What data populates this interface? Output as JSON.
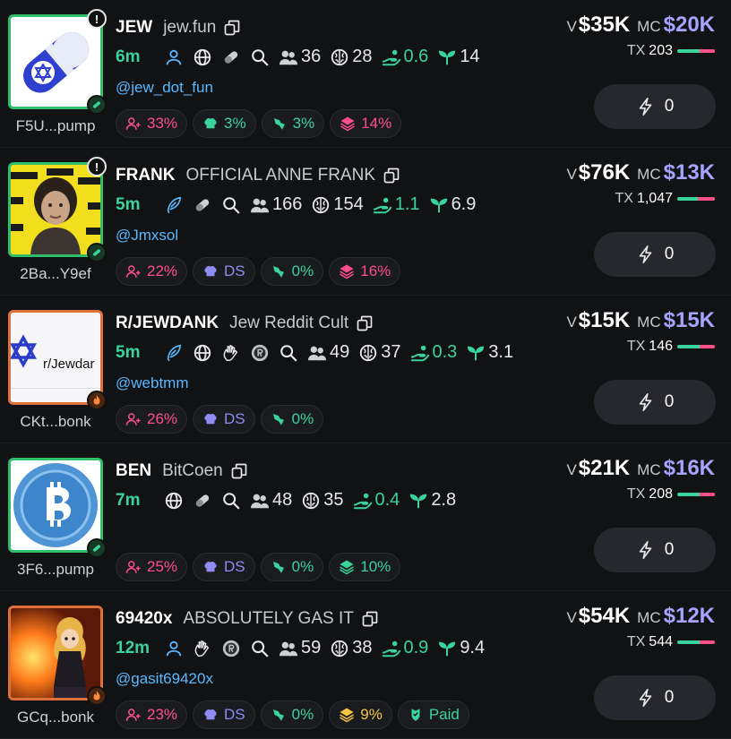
{
  "labels": {
    "volume": "V",
    "market_cap": "MC",
    "tx": "TX",
    "dot": "·"
  },
  "tokens": [
    {
      "ticker": "JEW",
      "name": "jew.fun",
      "age": "6m",
      "address": "F5U...pump",
      "handle": "@jew_dot_fun",
      "warning": "!",
      "holders": "36",
      "top10": "28",
      "dev": "0.6",
      "snipers": "14",
      "volume": "$35K",
      "market_cap": "$20K",
      "tx": "203",
      "buy_ratio": 0.6,
      "buy_amount": "0",
      "source": "pump",
      "pills": [
        {
          "icon": "holders-plus-icon",
          "value": "33%",
          "color": "pink"
        },
        {
          "icon": "chef-hat-icon",
          "value": "3%",
          "color": "grn"
        },
        {
          "icon": "sniper-icon",
          "value": "3%",
          "color": "grn"
        },
        {
          "icon": "layers-icon",
          "value": "14%",
          "color": "pink"
        }
      ]
    },
    {
      "ticker": "FRANK",
      "name": "OFFICIAL ANNE FRANK",
      "age": "5m",
      "address": "2Ba...Y9ef",
      "handle": "@Jmxsol",
      "warning": "!",
      "holders": "166",
      "top10": "154",
      "dev": "1.1",
      "snipers": "6.9",
      "volume": "$76K",
      "market_cap": "$13K",
      "tx": "1,047",
      "buy_ratio": 0.55,
      "buy_amount": "0",
      "source": "pump",
      "pills": [
        {
          "icon": "holders-plus-icon",
          "value": "22%",
          "color": "pink"
        },
        {
          "icon": "chef-hat-icon",
          "value": "DS",
          "color": "vio"
        },
        {
          "icon": "sniper-icon",
          "value": "0%",
          "color": "grn"
        },
        {
          "icon": "layers-icon",
          "value": "16%",
          "color": "pink"
        }
      ]
    },
    {
      "ticker": "R/JEWDANK",
      "name": "Jew Reddit Cult",
      "age": "5m",
      "address": "CKt...bonk",
      "handle": "@webtmm",
      "thumb_text": "r/Jewdar",
      "holders": "49",
      "top10": "37",
      "dev": "0.3",
      "snipers": "3.1",
      "volume": "$15K",
      "market_cap": "$15K",
      "tx": "146",
      "buy_ratio": 0.6,
      "buy_amount": "0",
      "source": "bonk",
      "pills": [
        {
          "icon": "holders-plus-icon",
          "value": "26%",
          "color": "pink"
        },
        {
          "icon": "chef-hat-icon",
          "value": "DS",
          "color": "vio"
        },
        {
          "icon": "sniper-icon",
          "value": "0%",
          "color": "grn"
        }
      ]
    },
    {
      "ticker": "BEN",
      "name": "BitCoen",
      "age": "7m",
      "address": "3F6...pump",
      "handle": "",
      "holders": "48",
      "top10": "35",
      "dev": "0.4",
      "snipers": "2.8",
      "volume": "$21K",
      "market_cap": "$16K",
      "tx": "208",
      "buy_ratio": 0.6,
      "buy_amount": "0",
      "source": "pump",
      "pills": [
        {
          "icon": "holders-plus-icon",
          "value": "25%",
          "color": "pink"
        },
        {
          "icon": "chef-hat-icon",
          "value": "DS",
          "color": "vio"
        },
        {
          "icon": "sniper-icon",
          "value": "0%",
          "color": "grn"
        },
        {
          "icon": "layers-icon",
          "value": "10%",
          "color": "grn"
        }
      ]
    },
    {
      "ticker": "69420x",
      "name": "ABSOLUTELY GAS IT",
      "age": "12m",
      "address": "GCq...bonk",
      "handle": "@gasit69420x",
      "holders": "59",
      "top10": "38",
      "dev": "0.9",
      "snipers": "9.4",
      "volume": "$54K",
      "market_cap": "$12K",
      "tx": "544",
      "buy_ratio": 0.6,
      "buy_amount": "0",
      "source": "bonk",
      "pills": [
        {
          "icon": "holders-plus-icon",
          "value": "23%",
          "color": "pink"
        },
        {
          "icon": "chef-hat-icon",
          "value": "DS",
          "color": "vio"
        },
        {
          "icon": "sniper-icon",
          "value": "0%",
          "color": "grn"
        },
        {
          "icon": "layers-icon",
          "value": "9%",
          "color": "yel"
        },
        {
          "icon": "paid-icon",
          "value": "Paid",
          "color": "grn"
        }
      ]
    }
  ],
  "colors": {
    "green": "#3ad39b",
    "pink": "#ff4f8b",
    "violet": "#8f8cf2",
    "yellow": "#f5c542",
    "mc": "#a7a4ff"
  }
}
